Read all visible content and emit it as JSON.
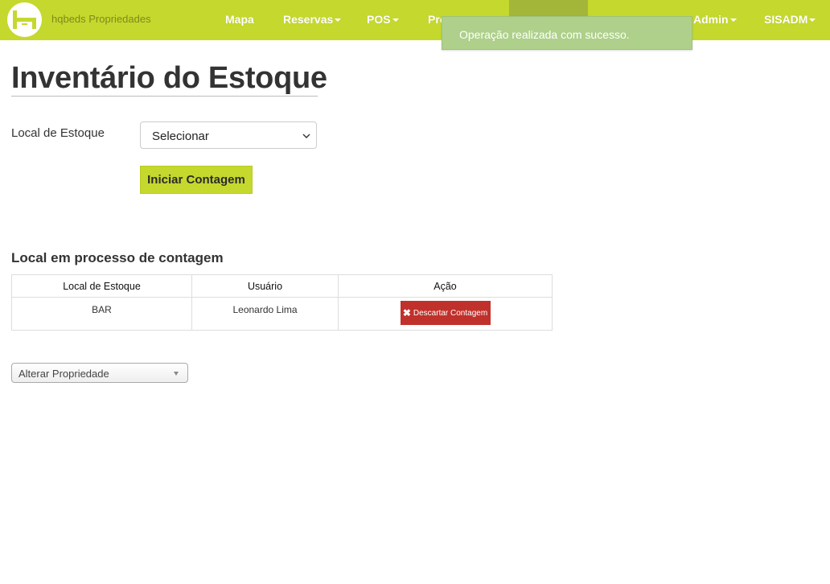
{
  "brand": {
    "name": "hqbeds Propriedades",
    "logo_icon": "hq-logo-icon"
  },
  "nav": {
    "items": [
      {
        "label": "Mapa",
        "dropdown": false
      },
      {
        "label": "Reservas",
        "dropdown": true
      },
      {
        "label": "POS",
        "dropdown": true
      },
      {
        "label": "Pro",
        "dropdown": false
      },
      {
        "label": "Admin",
        "dropdown": true
      },
      {
        "label": "SISADM",
        "dropdown": true
      }
    ]
  },
  "toast": {
    "message": "Operação realizada com sucesso."
  },
  "page": {
    "title": "Inventário do Estoque"
  },
  "form": {
    "stock_label": "Local de Estoque",
    "stock_select_value": "Selecionar",
    "start_button": "Iniciar Contagem"
  },
  "section": {
    "title": "Local em processo de contagem",
    "table": {
      "headers": [
        "Local de Estoque",
        "Usuário",
        "Ação"
      ],
      "rows": [
        {
          "local": "BAR",
          "usuario": "Leonardo Lima",
          "action_label": "Descartar Contagem"
        }
      ]
    }
  },
  "property_select": {
    "value": "Alterar Propriedade"
  },
  "colors": {
    "brand": "#c5d82e",
    "nav_active": "#a3b63a",
    "toast": "#aed08a",
    "danger": "#c0312b"
  }
}
